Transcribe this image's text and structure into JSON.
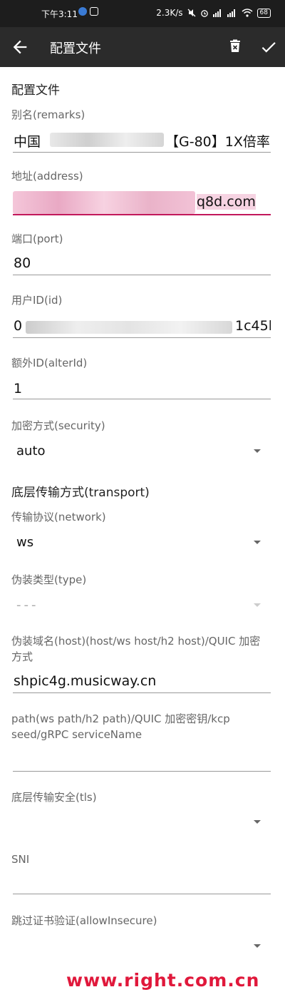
{
  "status_bar": {
    "time": "下午3:11",
    "speed": "2.3K/s",
    "battery": "68"
  },
  "toolbar": {
    "title": "配置文件"
  },
  "form": {
    "section_profile": "配置文件",
    "remarks_label": "别名(remarks)",
    "remarks_value_start": "中国",
    "remarks_value_end": "【G-80】1X倍率",
    "address_label": "地址(address)",
    "address_value_end": "q8d.com",
    "port_label": "端口(port)",
    "port_value": "80",
    "id_label": "用户ID(id)",
    "id_value_start": "0",
    "id_value_end": "1c45l",
    "alterid_label": "额外ID(alterId)",
    "alterid_value": "1",
    "security_label": "加密方式(security)",
    "security_value": "auto",
    "section_transport": "底层传输方式(transport)",
    "network_label": "传输协议(network)",
    "network_value": "ws",
    "type_label": "伪装类型(type)",
    "type_value": "---",
    "host_label": "伪装域名(host)(host/ws host/h2 host)/QUIC 加密方式",
    "host_value": "shpic4g.musicway.cn",
    "path_label": "path(ws path/h2 path)/QUIC 加密密钥/kcp seed/gRPC serviceName",
    "path_value": "",
    "tls_label": "底层传输安全(tls)",
    "tls_value": "",
    "sni_label": "SNI",
    "sni_value": "",
    "insecure_label": "跳过证书验证(allowInsecure)",
    "insecure_value": ""
  },
  "watermark": "www.right.com.cn"
}
